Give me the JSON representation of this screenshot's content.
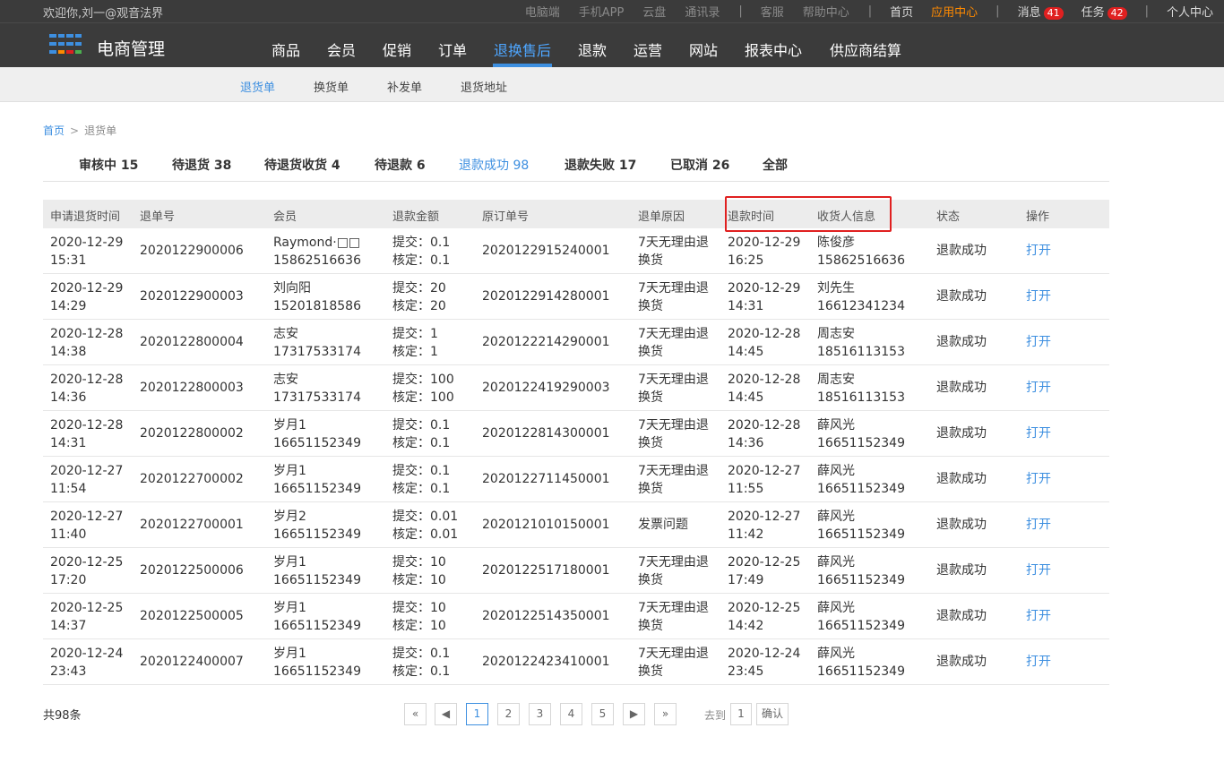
{
  "topbar": {
    "welcome": "欢迎你,刘一@观音法界",
    "links": [
      {
        "label": "电脑端",
        "style": "dim"
      },
      {
        "label": "手机APP",
        "style": "dim"
      },
      {
        "label": "云盘",
        "style": "dim"
      },
      {
        "label": "通讯录",
        "style": "dim"
      },
      {
        "label": "|",
        "style": "sep"
      },
      {
        "label": "客服",
        "style": "dim"
      },
      {
        "label": "帮助中心",
        "style": "dim"
      },
      {
        "label": "|",
        "style": "sep"
      },
      {
        "label": "首页",
        "style": "bright"
      },
      {
        "label": "应用中心",
        "style": "accent"
      },
      {
        "label": "|",
        "style": "sep"
      },
      {
        "label": "消息",
        "style": "bright",
        "badge": "41"
      },
      {
        "label": "任务",
        "style": "bright",
        "badge": "42"
      },
      {
        "label": "|",
        "style": "sep"
      },
      {
        "label": "个人中心",
        "style": "bright"
      }
    ]
  },
  "brand": {
    "name": "电商管理",
    "logo_colors": [
      "#3d8fe0",
      "#3d8fe0",
      "#ff8a00",
      "#e02020",
      "#4caf50"
    ]
  },
  "nav": {
    "items": [
      "商品",
      "会员",
      "促销",
      "订单",
      "退换售后",
      "退款",
      "运营",
      "网站",
      "报表中心",
      "供应商结算"
    ],
    "active": "退换售后"
  },
  "subnav": {
    "items": [
      "退货单",
      "换货单",
      "补发单",
      "退货地址"
    ],
    "active": "退货单"
  },
  "breadcrumb": {
    "home": "首页",
    "arrow": ">",
    "current": "退货单"
  },
  "status_tabs": {
    "items": [
      "审核中 15",
      "待退货 38",
      "待退货收货 4",
      "待退款 6",
      "退款成功 98",
      "退款失败 17",
      "已取消 26",
      "全部"
    ],
    "active": "退款成功 98"
  },
  "table": {
    "headers": [
      "申请退货时间",
      "退单号",
      "会员",
      "退款金额",
      "原订单号",
      "退单原因",
      "退款时间",
      "收货人信息",
      "状态",
      "操作"
    ],
    "rows": [
      {
        "apply": [
          "2020-12-29",
          "15:31"
        ],
        "no": "2020122900006",
        "member": [
          "Raymond·□□",
          "15862516636"
        ],
        "amount": [
          "提交：0.1",
          "核定：0.1"
        ],
        "order": "2020122915240001",
        "reason": [
          "7天无理由退",
          "换货"
        ],
        "refund": [
          "2020-12-29",
          "16:25"
        ],
        "receiver": [
          "陈俊彦",
          "15862516636"
        ],
        "status": "退款成功",
        "action": "打开"
      },
      {
        "apply": [
          "2020-12-29",
          "14:29"
        ],
        "no": "2020122900003",
        "member": [
          "刘向阳",
          "15201818586"
        ],
        "amount": [
          "提交：20",
          "核定：20"
        ],
        "order": "2020122914280001",
        "reason": [
          "7天无理由退",
          "换货"
        ],
        "refund": [
          "2020-12-29",
          "14:31"
        ],
        "receiver": [
          "刘先生",
          "16612341234"
        ],
        "status": "退款成功",
        "action": "打开"
      },
      {
        "apply": [
          "2020-12-28",
          "14:38"
        ],
        "no": "2020122800004",
        "member": [
          "志安",
          "17317533174"
        ],
        "amount": [
          "提交：1",
          "核定：1"
        ],
        "order": "2020122214290001",
        "reason": [
          "7天无理由退",
          "换货"
        ],
        "refund": [
          "2020-12-28",
          "14:45"
        ],
        "receiver": [
          "周志安",
          "18516113153"
        ],
        "status": "退款成功",
        "action": "打开"
      },
      {
        "apply": [
          "2020-12-28",
          "14:36"
        ],
        "no": "2020122800003",
        "member": [
          "志安",
          "17317533174"
        ],
        "amount": [
          "提交：100",
          "核定：100"
        ],
        "order": "2020122419290003",
        "reason": [
          "7天无理由退",
          "换货"
        ],
        "refund": [
          "2020-12-28",
          "14:45"
        ],
        "receiver": [
          "周志安",
          "18516113153"
        ],
        "status": "退款成功",
        "action": "打开"
      },
      {
        "apply": [
          "2020-12-28",
          "14:31"
        ],
        "no": "2020122800002",
        "member": [
          "岁月1",
          "16651152349"
        ],
        "amount": [
          "提交：0.1",
          "核定：0.1"
        ],
        "order": "2020122814300001",
        "reason": [
          "7天无理由退",
          "换货"
        ],
        "refund": [
          "2020-12-28",
          "14:36"
        ],
        "receiver": [
          "薛风光",
          "16651152349"
        ],
        "status": "退款成功",
        "action": "打开"
      },
      {
        "apply": [
          "2020-12-27",
          "11:54"
        ],
        "no": "2020122700002",
        "member": [
          "岁月1",
          "16651152349"
        ],
        "amount": [
          "提交：0.1",
          "核定：0.1"
        ],
        "order": "2020122711450001",
        "reason": [
          "7天无理由退",
          "换货"
        ],
        "refund": [
          "2020-12-27",
          "11:55"
        ],
        "receiver": [
          "薛风光",
          "16651152349"
        ],
        "status": "退款成功",
        "action": "打开"
      },
      {
        "apply": [
          "2020-12-27",
          "11:40"
        ],
        "no": "2020122700001",
        "member": [
          "岁月2",
          "16651152349"
        ],
        "amount": [
          "提交：0.01",
          "核定：0.01"
        ],
        "order": "2020121010150001",
        "reason": [
          "发票问题"
        ],
        "refund": [
          "2020-12-27",
          "11:42"
        ],
        "receiver": [
          "薛风光",
          "16651152349"
        ],
        "status": "退款成功",
        "action": "打开"
      },
      {
        "apply": [
          "2020-12-25",
          "17:20"
        ],
        "no": "2020122500006",
        "member": [
          "岁月1",
          "16651152349"
        ],
        "amount": [
          "提交：10",
          "核定：10"
        ],
        "order": "2020122517180001",
        "reason": [
          "7天无理由退",
          "换货"
        ],
        "refund": [
          "2020-12-25",
          "17:49"
        ],
        "receiver": [
          "薛风光",
          "16651152349"
        ],
        "status": "退款成功",
        "action": "打开"
      },
      {
        "apply": [
          "2020-12-25",
          "14:37"
        ],
        "no": "2020122500005",
        "member": [
          "岁月1",
          "16651152349"
        ],
        "amount": [
          "提交：10",
          "核定：10"
        ],
        "order": "2020122514350001",
        "reason": [
          "7天无理由退",
          "换货"
        ],
        "refund": [
          "2020-12-25",
          "14:42"
        ],
        "receiver": [
          "薛风光",
          "16651152349"
        ],
        "status": "退款成功",
        "action": "打开"
      },
      {
        "apply": [
          "2020-12-24",
          "23:43"
        ],
        "no": "2020122400007",
        "member": [
          "岁月1",
          "16651152349"
        ],
        "amount": [
          "提交：0.1",
          "核定：0.1"
        ],
        "order": "2020122423410001",
        "reason": [
          "7天无理由退",
          "换货"
        ],
        "refund": [
          "2020-12-24",
          "23:45"
        ],
        "receiver": [
          "薛风光",
          "16651152349"
        ],
        "status": "退款成功",
        "action": "打开"
      }
    ]
  },
  "footer": {
    "total": "共98条",
    "pager": {
      "first": "«",
      "prev": "◀",
      "pages": [
        "1",
        "2",
        "3",
        "4",
        "5"
      ],
      "current": "1",
      "next": "▶",
      "last": "»",
      "goto_label": "去到",
      "goto_value": "1",
      "confirm": "确认"
    }
  },
  "colors": {
    "accent": "#3d8fe0",
    "highlight_box": "#e02020",
    "orange": "#ff8a00",
    "dark_bar": "#3b3b3b"
  }
}
